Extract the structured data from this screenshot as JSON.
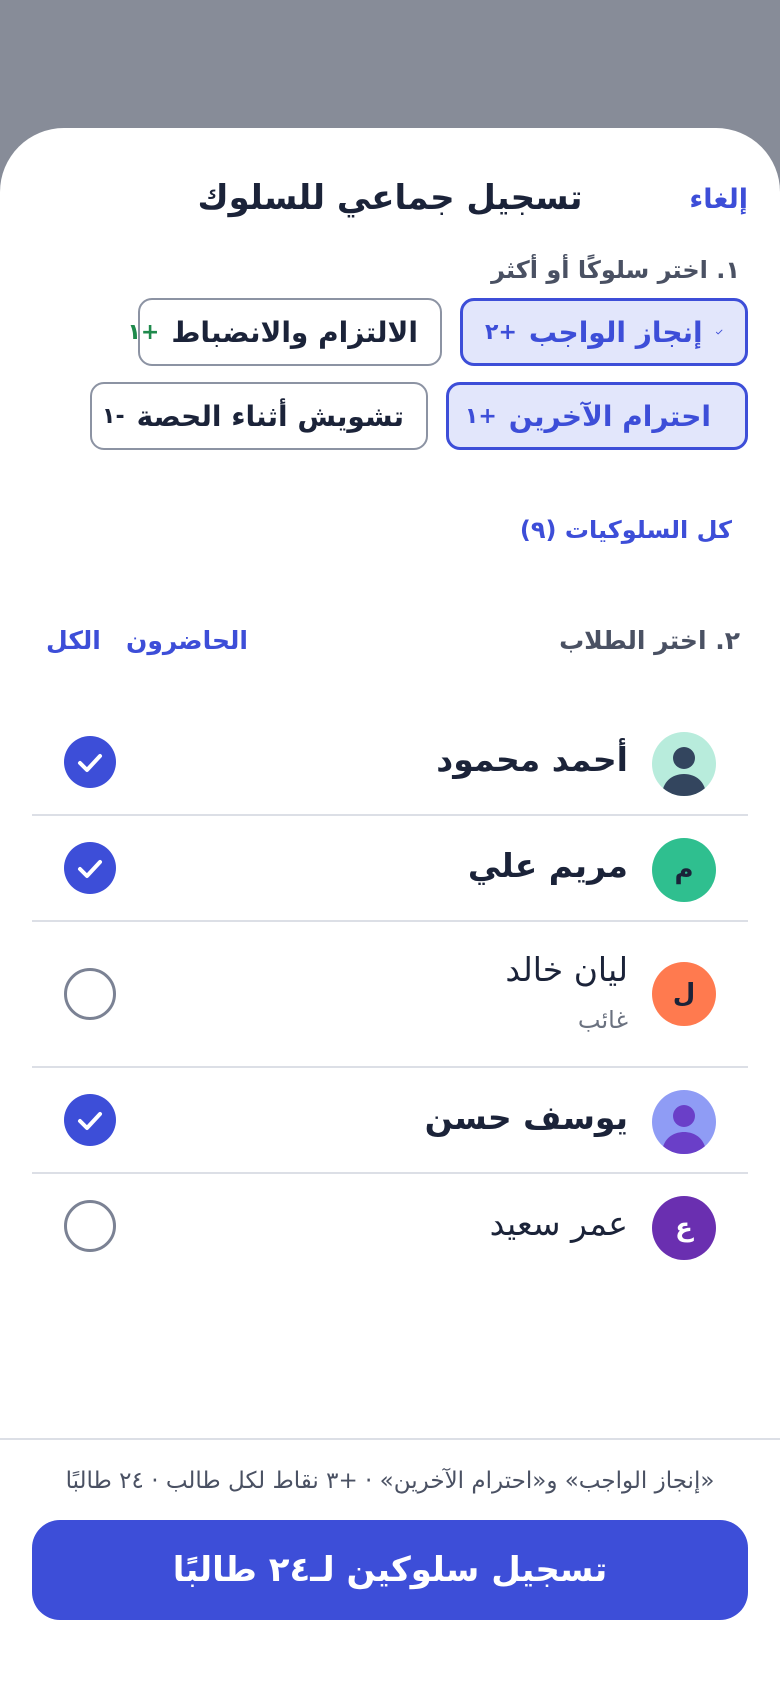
{
  "header": {
    "cancel_label": "إلغاء",
    "title": "تسجيل جماعي للسلوك"
  },
  "behaviors": {
    "section_label": "١. اختر سلوكًا أو أكثر",
    "chips": [
      {
        "label": "إنجاز الواجب",
        "points": "+٢",
        "selected": true,
        "points_color": "#3d4ed8"
      },
      {
        "label": "الالتزام والانضباط",
        "points": "+١",
        "selected": false,
        "points_color": "#1f8a4c"
      },
      {
        "label": "احترام الآخرين",
        "points": "+١",
        "selected": true,
        "points_color": "#3d4ed8"
      },
      {
        "label": "تشويش أثناء الحصة",
        "points": "-١",
        "selected": false,
        "points_color": "#1b2339"
      }
    ],
    "all_link": "كل السلوكيات (٩)"
  },
  "students": {
    "section_label": "٢. اختر الطلاب",
    "filter_present": "الحاضرون",
    "filter_all": "الكل",
    "list": [
      {
        "name": "أحمد محمود",
        "initial": "",
        "avatar_type": "person",
        "avatar_bg": "#b8ecdc",
        "note": "",
        "checked": true
      },
      {
        "name": "مريم علي",
        "initial": "م",
        "avatar_type": "letter",
        "avatar_bg": "#2fbf8f",
        "note": "",
        "checked": true
      },
      {
        "name": "ليان خالد",
        "initial": "ل",
        "avatar_type": "letter",
        "avatar_bg": "#ff7a4f",
        "note": "غائب",
        "checked": false
      },
      {
        "name": "يوسف حسن",
        "initial": "",
        "avatar_type": "person",
        "avatar_bg": "#8f9cf5",
        "note": "",
        "checked": true
      },
      {
        "name": "عمر سعيد",
        "initial": "ع",
        "avatar_type": "letter",
        "avatar_bg": "#6a2fb0",
        "note": "",
        "checked": false
      }
    ]
  },
  "footer": {
    "summary": "«إنجاز الواجب» و«احترام الآخرين» · +٣ نقاط لكل طالب · ٢٤ طالبًا",
    "submit_label": "تسجيل سلوكين لـ٢٤ طالبًا"
  },
  "colors": {
    "accent": "#3d4ed8",
    "accent_light": "#e2e6fb"
  },
  "icons": {
    "check": "check-icon",
    "person": "person-icon"
  }
}
